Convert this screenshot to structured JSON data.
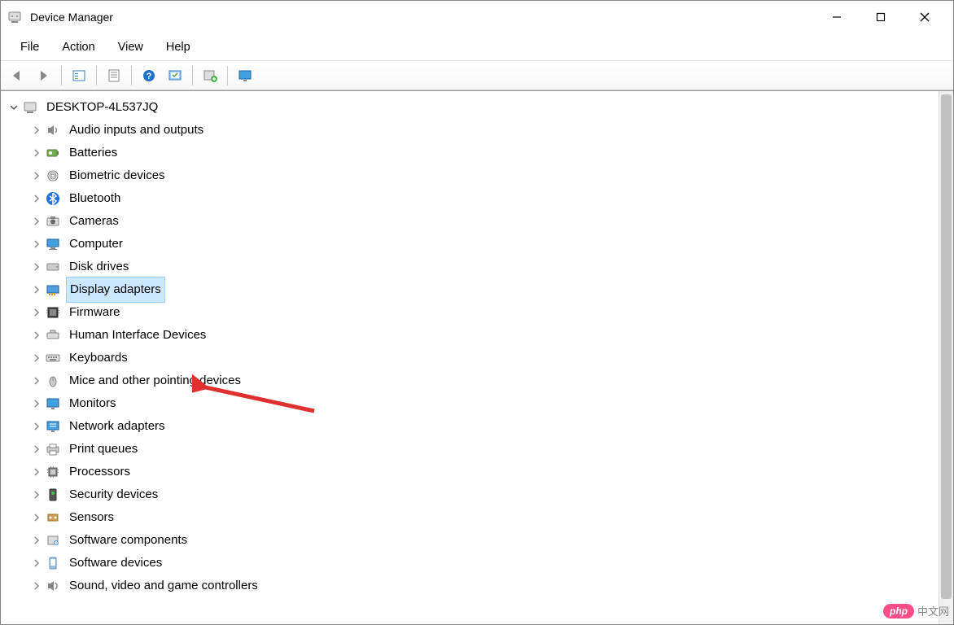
{
  "window": {
    "title": "Device Manager"
  },
  "menubar": {
    "file": "File",
    "action": "Action",
    "view": "View",
    "help": "Help"
  },
  "toolbar": {
    "back": "back-icon",
    "forward": "forward-icon",
    "show_hidden": "tree-icon",
    "properties": "properties-icon",
    "help": "help-icon",
    "scan": "scan-icon",
    "update": "update-icon",
    "monitor": "monitor-icon"
  },
  "tree": {
    "root": "DESKTOP-4L537JQ",
    "items": [
      {
        "label": "Audio inputs and outputs",
        "icon": "speaker-icon"
      },
      {
        "label": "Batteries",
        "icon": "battery-icon"
      },
      {
        "label": "Biometric devices",
        "icon": "fingerprint-icon"
      },
      {
        "label": "Bluetooth",
        "icon": "bluetooth-icon"
      },
      {
        "label": "Cameras",
        "icon": "camera-icon"
      },
      {
        "label": "Computer",
        "icon": "computer-icon"
      },
      {
        "label": "Disk drives",
        "icon": "disk-icon"
      },
      {
        "label": "Display adapters",
        "icon": "display-adapter-icon",
        "selected": true
      },
      {
        "label": "Firmware",
        "icon": "firmware-icon"
      },
      {
        "label": "Human Interface Devices",
        "icon": "hid-icon"
      },
      {
        "label": "Keyboards",
        "icon": "keyboard-icon"
      },
      {
        "label": "Mice and other pointing devices",
        "icon": "mouse-icon"
      },
      {
        "label": "Monitors",
        "icon": "monitor-cat-icon"
      },
      {
        "label": "Network adapters",
        "icon": "network-icon"
      },
      {
        "label": "Print queues",
        "icon": "printer-icon"
      },
      {
        "label": "Processors",
        "icon": "cpu-icon"
      },
      {
        "label": "Security devices",
        "icon": "security-icon"
      },
      {
        "label": "Sensors",
        "icon": "sensor-icon"
      },
      {
        "label": "Software components",
        "icon": "software-comp-icon"
      },
      {
        "label": "Software devices",
        "icon": "software-dev-icon"
      },
      {
        "label": "Sound, video and game controllers",
        "icon": "sound-icon"
      }
    ]
  },
  "watermark": {
    "badge": "php",
    "text": "中文网"
  }
}
